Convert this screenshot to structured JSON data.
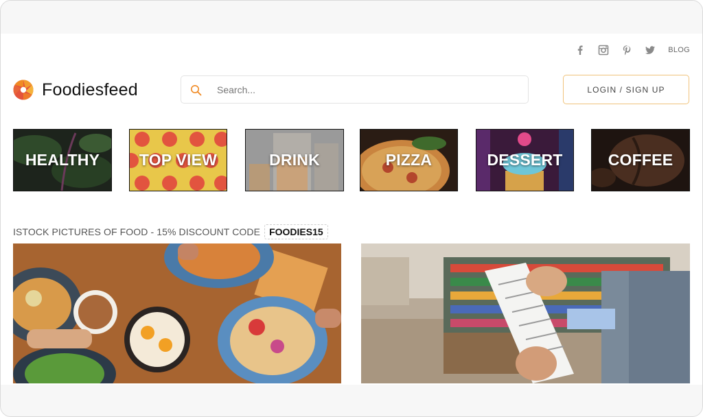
{
  "social": {
    "icons": [
      "facebook-icon",
      "instagram-icon",
      "pinterest-icon",
      "twitter-icon"
    ],
    "blog_label": "BLOG"
  },
  "header": {
    "brand": "Foodiesfeed",
    "search_placeholder": "Search...",
    "login_label": "LOGIN / SIGN UP"
  },
  "categories": [
    {
      "label": "HEALTHY"
    },
    {
      "label": "TOP VIEW"
    },
    {
      "label": "DRINK"
    },
    {
      "label": "PIZZA"
    },
    {
      "label": "DESSERT"
    },
    {
      "label": "COFFEE"
    }
  ],
  "promo": {
    "text": "ISTOCK PICTURES OF FOOD - 15% DISCOUNT CODE",
    "code": "FOODIES15"
  },
  "colors": {
    "accent": "#f08a24",
    "logo_red": "#e4543b",
    "text_dark": "#111111",
    "muted": "#8a8a8a"
  }
}
